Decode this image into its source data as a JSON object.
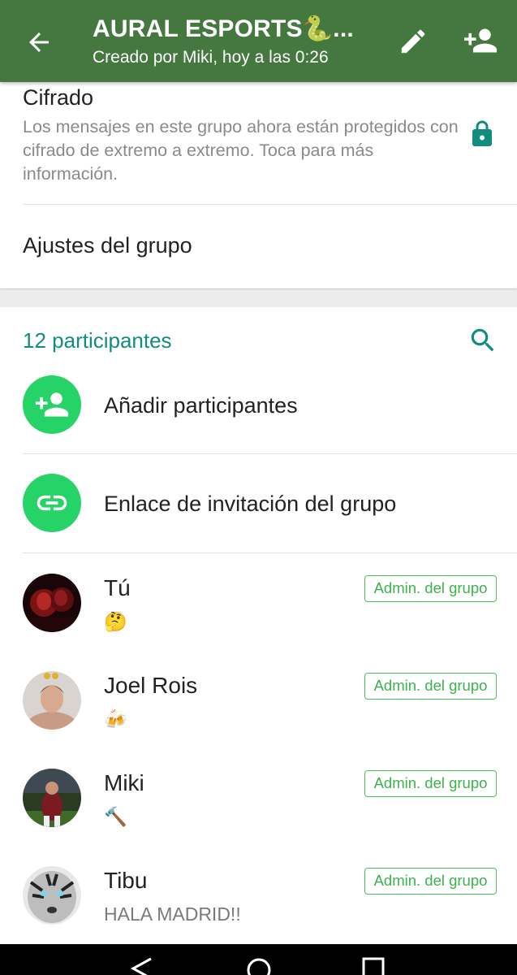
{
  "header": {
    "title": "AURAL ESPORTS🐍...",
    "subtitle": "Creado por Miki, hoy a las 0:26",
    "color": "#44783f"
  },
  "encryption": {
    "title": "Cifrado",
    "description": "Los mensajes en este grupo ahora están protegidos con cifrado de extremo a extremo. Toca para más información."
  },
  "settings": {
    "label": "Ajustes del grupo"
  },
  "participants": {
    "count_label": "12 participantes",
    "add_label": "Añadir participantes",
    "invite_label": "Enlace de invitación del grupo",
    "members": [
      {
        "name": "Tú",
        "status": "🤔",
        "badge": "Admin. del grupo"
      },
      {
        "name": "Joel Rois",
        "status": "🍻",
        "badge": "Admin. del grupo"
      },
      {
        "name": "Miki",
        "status": "🔨",
        "badge": "Admin. del grupo"
      },
      {
        "name": "Tibu",
        "status": "HALA MADRID!!",
        "badge": "Admin. del grupo"
      }
    ]
  },
  "colors": {
    "accent": "#128c7e",
    "fab_green": "#25d366",
    "badge_green": "#3db24f"
  },
  "icons": [
    "back-arrow-icon",
    "edit-pencil-icon",
    "add-person-icon",
    "lock-icon",
    "search-icon",
    "link-icon",
    "nav-back-icon",
    "nav-home-icon",
    "nav-recents-icon"
  ]
}
